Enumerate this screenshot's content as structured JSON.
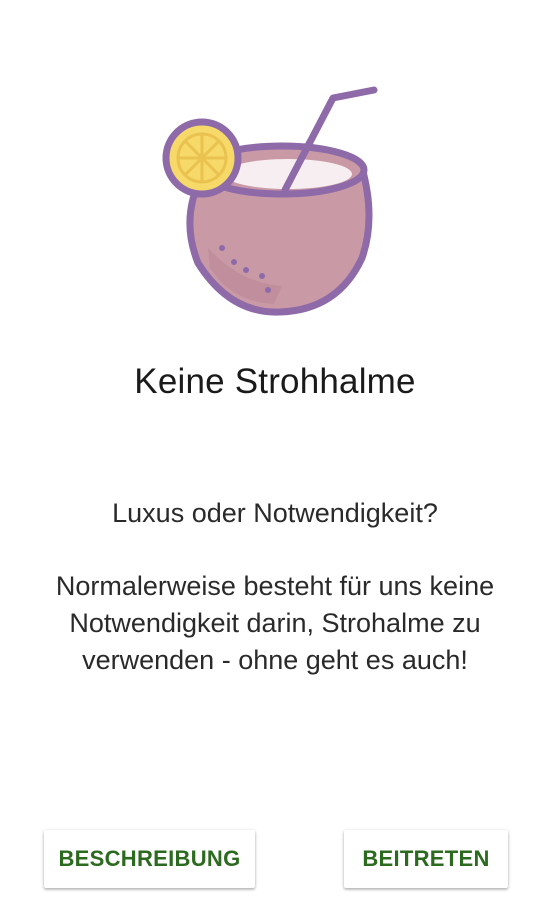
{
  "card": {
    "icon": "coconut-drink-icon",
    "title": "Keine Strohhalme",
    "subtitle": "Luxus oder Notwendigkeit?",
    "body": "Normalerweise besteht für uns keine Notwendigkeit darin, Strohalme zu verwenden - ohne geht es auch!"
  },
  "actions": {
    "description_label": "BESCHREIBUNG",
    "join_label": "BEITRETEN"
  },
  "colors": {
    "accent_text": "#2b6a1f",
    "icon_body": "#c99aa6",
    "icon_outline": "#8e6aa8",
    "icon_lemon": "#f7d96a"
  }
}
